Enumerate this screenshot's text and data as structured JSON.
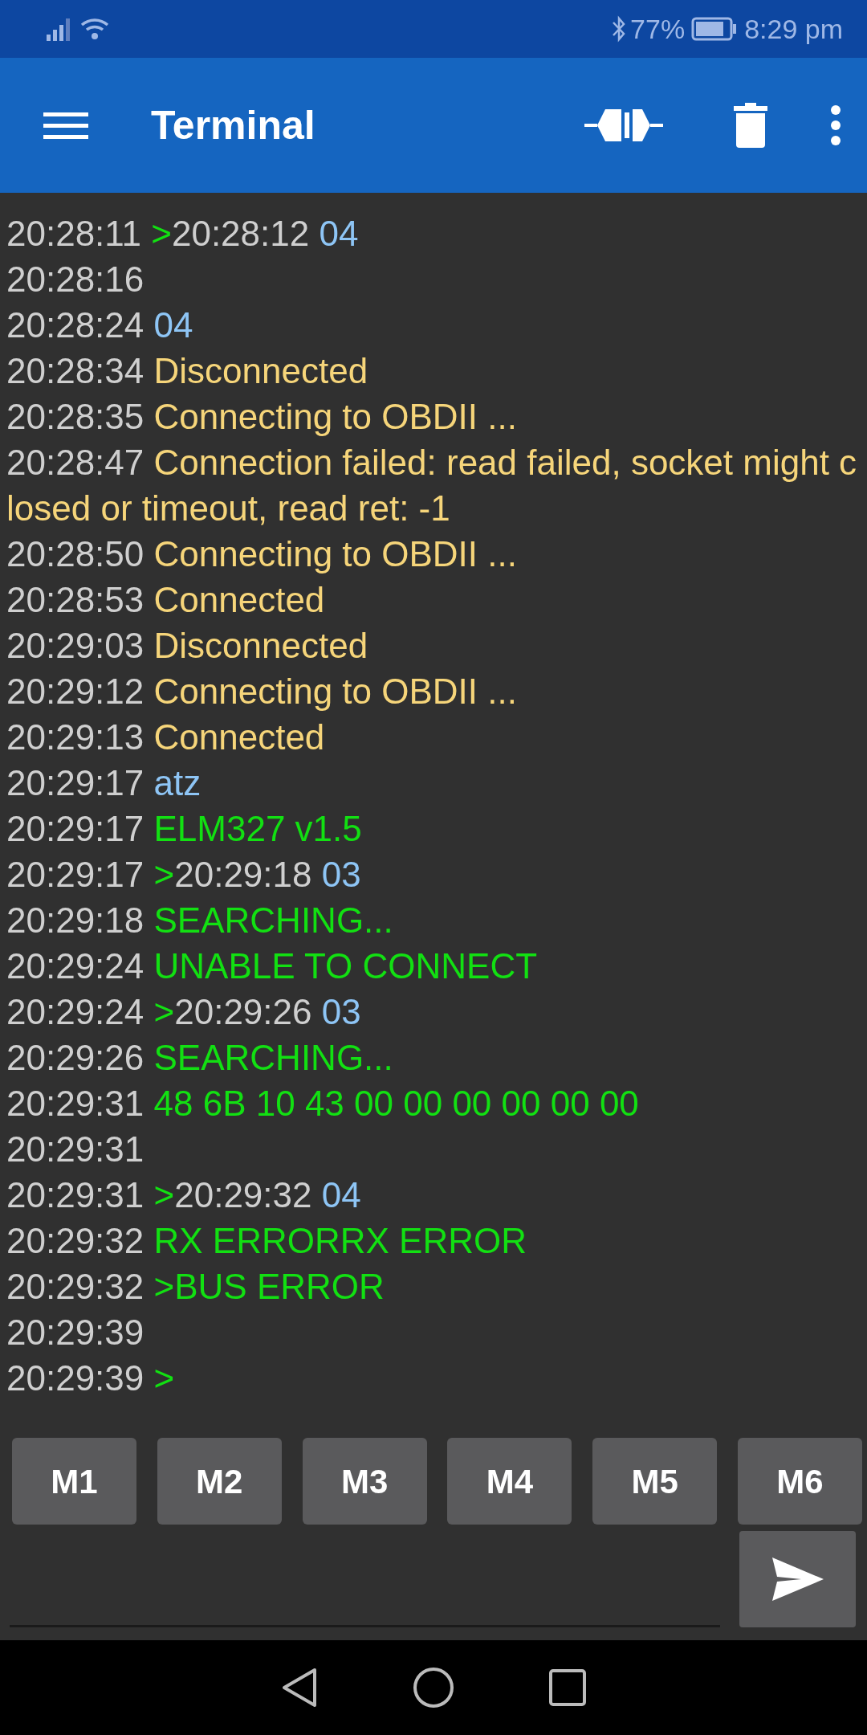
{
  "status_bar": {
    "battery": "77%",
    "time": "8:29 pm"
  },
  "app_bar": {
    "title": "Terminal"
  },
  "terminal": {
    "lines": [
      {
        "time": "20:28:11",
        "segments": [
          {
            "kind": "receive",
            "text": ">"
          },
          {
            "kind": "time",
            "text": "20:28:12"
          },
          {
            "kind": "send",
            "text": "04"
          }
        ]
      },
      {
        "time": "20:28:16"
      },
      {
        "time": "20:28:24",
        "segments": [
          {
            "kind": "send",
            "text": "04"
          }
        ]
      },
      {
        "time": "20:28:34",
        "segments": [
          {
            "kind": "status",
            "text": "Disconnected"
          }
        ]
      },
      {
        "time": "20:28:35",
        "segments": [
          {
            "kind": "status",
            "text": "Connecting to OBDII ..."
          }
        ]
      },
      {
        "time": "20:28:47",
        "segments": [
          {
            "kind": "status",
            "text": "Connection failed: read failed, socket might closed or timeout, read ret: -1"
          }
        ]
      },
      {
        "time": "20:28:50",
        "segments": [
          {
            "kind": "status",
            "text": "Connecting to OBDII ..."
          }
        ]
      },
      {
        "time": "20:28:53",
        "segments": [
          {
            "kind": "status",
            "text": "Connected"
          }
        ]
      },
      {
        "time": "20:29:03",
        "segments": [
          {
            "kind": "status",
            "text": "Disconnected"
          }
        ]
      },
      {
        "time": "20:29:12",
        "segments": [
          {
            "kind": "status",
            "text": "Connecting to OBDII ..."
          }
        ]
      },
      {
        "time": "20:29:13",
        "segments": [
          {
            "kind": "status",
            "text": "Connected"
          }
        ]
      },
      {
        "time": "20:29:17",
        "segments": [
          {
            "kind": "send",
            "text": "atz"
          }
        ]
      },
      {
        "time": "20:29:17",
        "segments": [
          {
            "kind": "receive",
            "text": "ELM327 v1.5"
          }
        ]
      },
      {
        "time": "20:29:17",
        "segments": [
          {
            "kind": "receive",
            "text": ">"
          },
          {
            "kind": "time",
            "text": "20:29:18"
          },
          {
            "kind": "send",
            "text": "03"
          }
        ]
      },
      {
        "time": "20:29:18",
        "segments": [
          {
            "kind": "receive",
            "text": "SEARCHING..."
          }
        ]
      },
      {
        "time": "20:29:24",
        "segments": [
          {
            "kind": "receive",
            "text": "UNABLE TO CONNECT"
          }
        ]
      },
      {
        "time": "20:29:24",
        "segments": [
          {
            "kind": "receive",
            "text": ">"
          },
          {
            "kind": "time",
            "text": "20:29:26"
          },
          {
            "kind": "send",
            "text": "03"
          }
        ]
      },
      {
        "time": "20:29:26",
        "segments": [
          {
            "kind": "receive",
            "text": "SEARCHING..."
          }
        ]
      },
      {
        "time": "20:29:31",
        "segments": [
          {
            "kind": "receive",
            "text": "48 6B 10 43 00 00 00 00 00 00"
          }
        ]
      },
      {
        "time": "20:29:31"
      },
      {
        "time": "20:29:31",
        "segments": [
          {
            "kind": "receive",
            "text": ">"
          },
          {
            "kind": "time",
            "text": "20:29:32"
          },
          {
            "kind": "send",
            "text": "04"
          }
        ]
      },
      {
        "time": "20:29:32",
        "segments": [
          {
            "kind": "receive",
            "text": "RX ERRORRX ERROR"
          }
        ]
      },
      {
        "time": "20:29:32",
        "segments": [
          {
            "kind": "receive",
            "text": ">BUS ERROR"
          }
        ]
      },
      {
        "time": "20:29:39"
      },
      {
        "time": "20:29:39",
        "segments": [
          {
            "kind": "receive",
            "text": ">"
          }
        ]
      }
    ]
  },
  "macro_buttons": [
    "M1",
    "M2",
    "M3",
    "M4",
    "M5",
    "M6"
  ]
}
